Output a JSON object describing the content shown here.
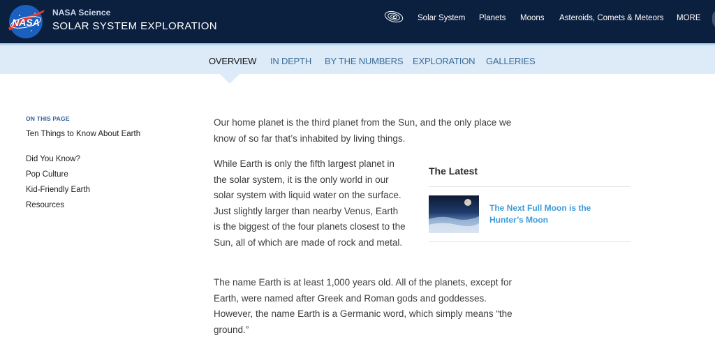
{
  "header": {
    "logo_text": "NASA",
    "site_subtitle": "NASA Science",
    "site_title": "SOLAR SYSTEM EXPLORATION",
    "nav": [
      "Solar System",
      "Planets",
      "Moons",
      "Asteroids, Comets & Meteors",
      "MORE"
    ]
  },
  "subnav": {
    "items": [
      "OVERVIEW",
      "IN DEPTH",
      "BY THE NUMBERS",
      "EXPLORATION",
      "GALLERIES"
    ],
    "active": "OVERVIEW"
  },
  "sidebar": {
    "label": "ON THIS PAGE",
    "links": [
      "Ten Things to Know About Earth",
      "Did You Know?",
      "Pop Culture",
      "Kid-Friendly Earth",
      "Resources"
    ]
  },
  "main": {
    "intro": "Our home planet is the third planet from the Sun, and the only place we know of so far that’s inhabited by living things.",
    "para2": "While Earth is only the fifth largest planet in the solar system, it is the only world in our solar system with liquid water on the surface. Just slightly larger than nearby Venus, Earth is the biggest of the four planets closest to the Sun, all of which are made of rock and metal.",
    "para3": "The name Earth is at least 1,000 years old. All of the planets, except for Earth, were named after Greek and Roman gods and goddesses. However, the name Earth is a Germanic word, which simply means “the ground.”"
  },
  "latest": {
    "title": "The Latest",
    "article_title": "The Next Full Moon is the Hunter’s Moon"
  },
  "colors": {
    "header_bg": "#0b1f3f",
    "subnav_bg": "#dcebf7",
    "link_blue": "#3d9bd9",
    "nasa_red": "#e03c31"
  }
}
